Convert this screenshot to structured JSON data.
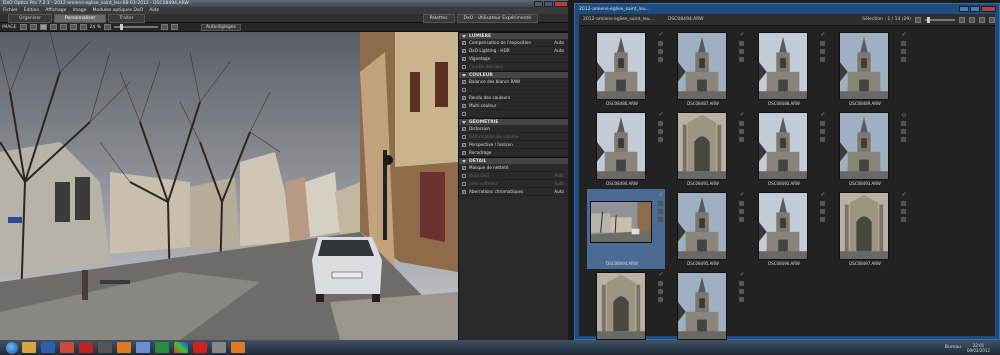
{
  "left_window": {
    "title": "DxO Optics Pro 7.2.1 - 2012-amiens-eglise_saint_leu-08-03-2012 - DSC08494.ARW",
    "menu": [
      "Fichier",
      "Edition",
      "Affichage",
      "Image",
      "Modules optiques DxO",
      "Aide"
    ],
    "tabs": [
      {
        "label": "Organiser",
        "active": false
      },
      {
        "label": "Personnaliser",
        "active": true
      },
      {
        "label": "Traiter",
        "active": false
      }
    ],
    "palettes_label": "Palettes",
    "workspace_label": "DxO - Utilisateur Expérimenté",
    "toolbar": {
      "image_label": "IMAGE",
      "zoom": "24 %",
      "autoset_label": "Autoréglages"
    },
    "panel": {
      "sections": [
        {
          "title": "LUMIÈRE",
          "rows": [
            {
              "label": "Compensation de l'exposition",
              "value": "Auto",
              "checked": true,
              "dim": false
            },
            {
              "label": "DxO Lighting - HDR",
              "value": "Auto",
              "checked": true,
              "dim": false
            },
            {
              "label": "Vignetage",
              "value": "",
              "checked": true,
              "dim": false
            },
            {
              "label": "Courbe des tons",
              "value": "",
              "checked": false,
              "dim": true
            }
          ]
        },
        {
          "title": "COULEUR",
          "rows": [
            {
              "label": "Balance des blancs RAW",
              "value": "",
              "checked": true,
              "dim": false
            },
            {
              "label": "",
              "value": "",
              "checked": false,
              "dim": true
            },
            {
              "label": "Rendu des couleurs",
              "value": "",
              "checked": true,
              "dim": false
            },
            {
              "label": "Multi-couleur",
              "value": "",
              "checked": true,
              "dim": false
            },
            {
              "label": "",
              "value": "",
              "checked": false,
              "dim": true
            }
          ]
        },
        {
          "title": "GÉOMÉTRIE",
          "rows": [
            {
              "label": "Distorsion",
              "value": "",
              "checked": true,
              "dim": false
            },
            {
              "label": "Déformation de volume",
              "value": "",
              "checked": false,
              "dim": true
            },
            {
              "label": "Perspective / horizon",
              "value": "",
              "checked": true,
              "dim": false
            },
            {
              "label": "Recadrage",
              "value": "",
              "checked": true,
              "dim": false
            }
          ]
        },
        {
          "title": "DÉTAIL",
          "rows": [
            {
              "label": "Masque de netteté",
              "value": "",
              "checked": true,
              "dim": false
            },
            {
              "label": "Bruit DxO",
              "value": "Auto",
              "checked": false,
              "dim": true
            },
            {
              "label": "Lens softness",
              "value": "Auto",
              "checked": false,
              "dim": true
            },
            {
              "label": "Aberrations chromatiques",
              "value": "Auto",
              "checked": true,
              "dim": false
            }
          ]
        }
      ]
    }
  },
  "right_window": {
    "title": "2012-amiens-eglise_saint_leu...",
    "path": "2012-amiens-eglise_saint_leu...",
    "file": "DSC08494.ARW",
    "selection": "Sélection : 1 / 14 (29)",
    "thumbnails": [
      {
        "name": "DSC08486.ARW",
        "kind": "tower",
        "selected": false,
        "status": "check"
      },
      {
        "name": "DSC08487.ARW",
        "kind": "tower",
        "selected": false,
        "status": "check"
      },
      {
        "name": "DSC08488.ARW",
        "kind": "tower",
        "selected": false,
        "status": "check"
      },
      {
        "name": "DSC08489.ARW",
        "kind": "tower",
        "selected": false,
        "status": "check"
      },
      {
        "name": "DSC08490.ARW",
        "kind": "tower",
        "selected": false,
        "status": "check"
      },
      {
        "name": "DSC08491.ARW",
        "kind": "facade",
        "selected": false,
        "status": "check"
      },
      {
        "name": "DSC08492.ARW",
        "kind": "tower",
        "selected": false,
        "status": "check"
      },
      {
        "name": "DSC08493.ARW",
        "kind": "tower",
        "selected": false,
        "status": "mod"
      },
      {
        "name": "DSC08494.ARW",
        "kind": "street",
        "selected": true,
        "status": "check"
      },
      {
        "name": "DSC08495.ARW",
        "kind": "tower",
        "selected": false,
        "status": "check"
      },
      {
        "name": "DSC08496.ARW",
        "kind": "tower",
        "selected": false,
        "status": "check"
      },
      {
        "name": "DSC08497.ARW",
        "kind": "facade",
        "selected": false,
        "status": "check"
      },
      {
        "name": "",
        "kind": "facade",
        "selected": false,
        "status": "check"
      },
      {
        "name": "",
        "kind": "tower",
        "selected": false,
        "status": "check"
      }
    ]
  },
  "taskbar": {
    "bureau_label": "Bureau",
    "time": "22:01",
    "date": "09/03/2012",
    "apps": [
      "explorer",
      "word",
      "chrome",
      "pdf",
      "dxo",
      "firefox",
      "itunes",
      "excel",
      "paint",
      "opera",
      "cpu",
      "firefox2"
    ]
  }
}
